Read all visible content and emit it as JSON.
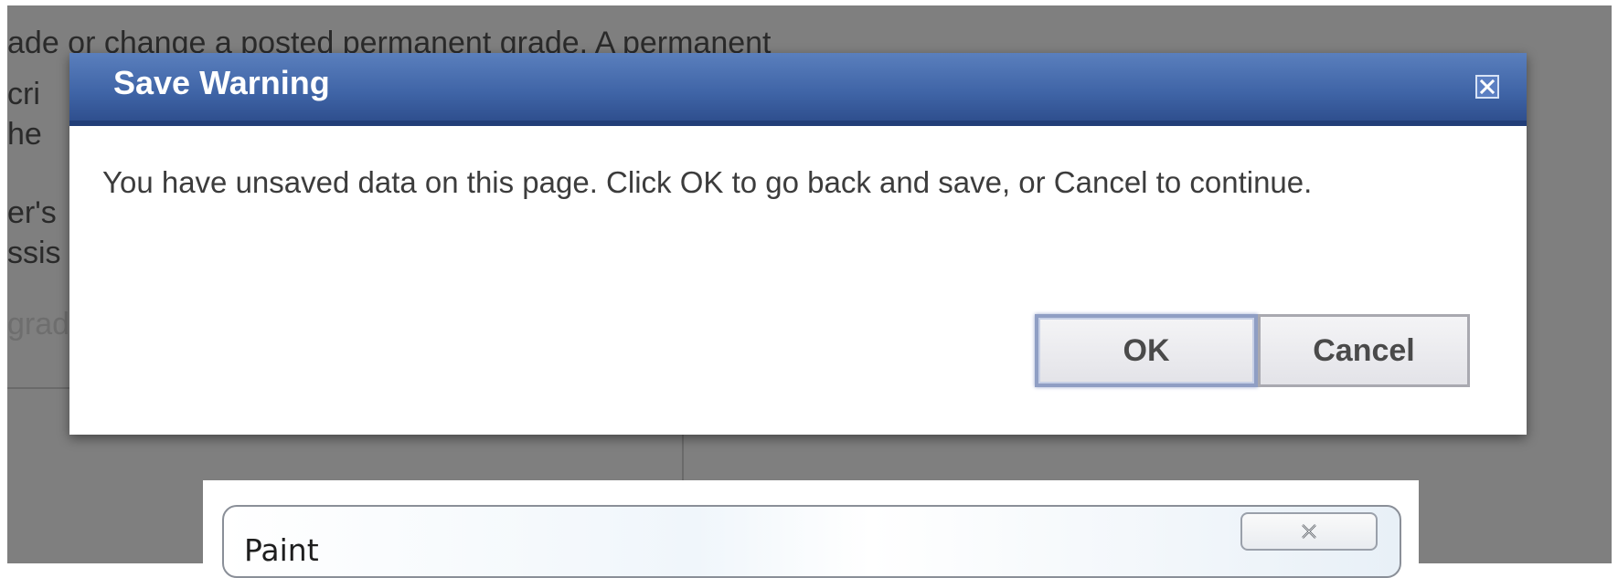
{
  "background": {
    "lines": [
      "ade or change a posted permanent grade. A permanent",
      "cri",
      "he",
      "er's",
      "ssis",
      "grad"
    ]
  },
  "dialog": {
    "title": "Save Warning",
    "close_icon": "close-icon",
    "message": "You have unsaved data on this page. Click OK to go back and save, or Cancel to continue.",
    "ok_label": "OK",
    "cancel_label": "Cancel",
    "colors": {
      "titlebar": "#3f64a6",
      "ok_border": "#8f9ec4"
    }
  },
  "paint_window": {
    "title": "Paint",
    "close_icon": "close-icon"
  }
}
